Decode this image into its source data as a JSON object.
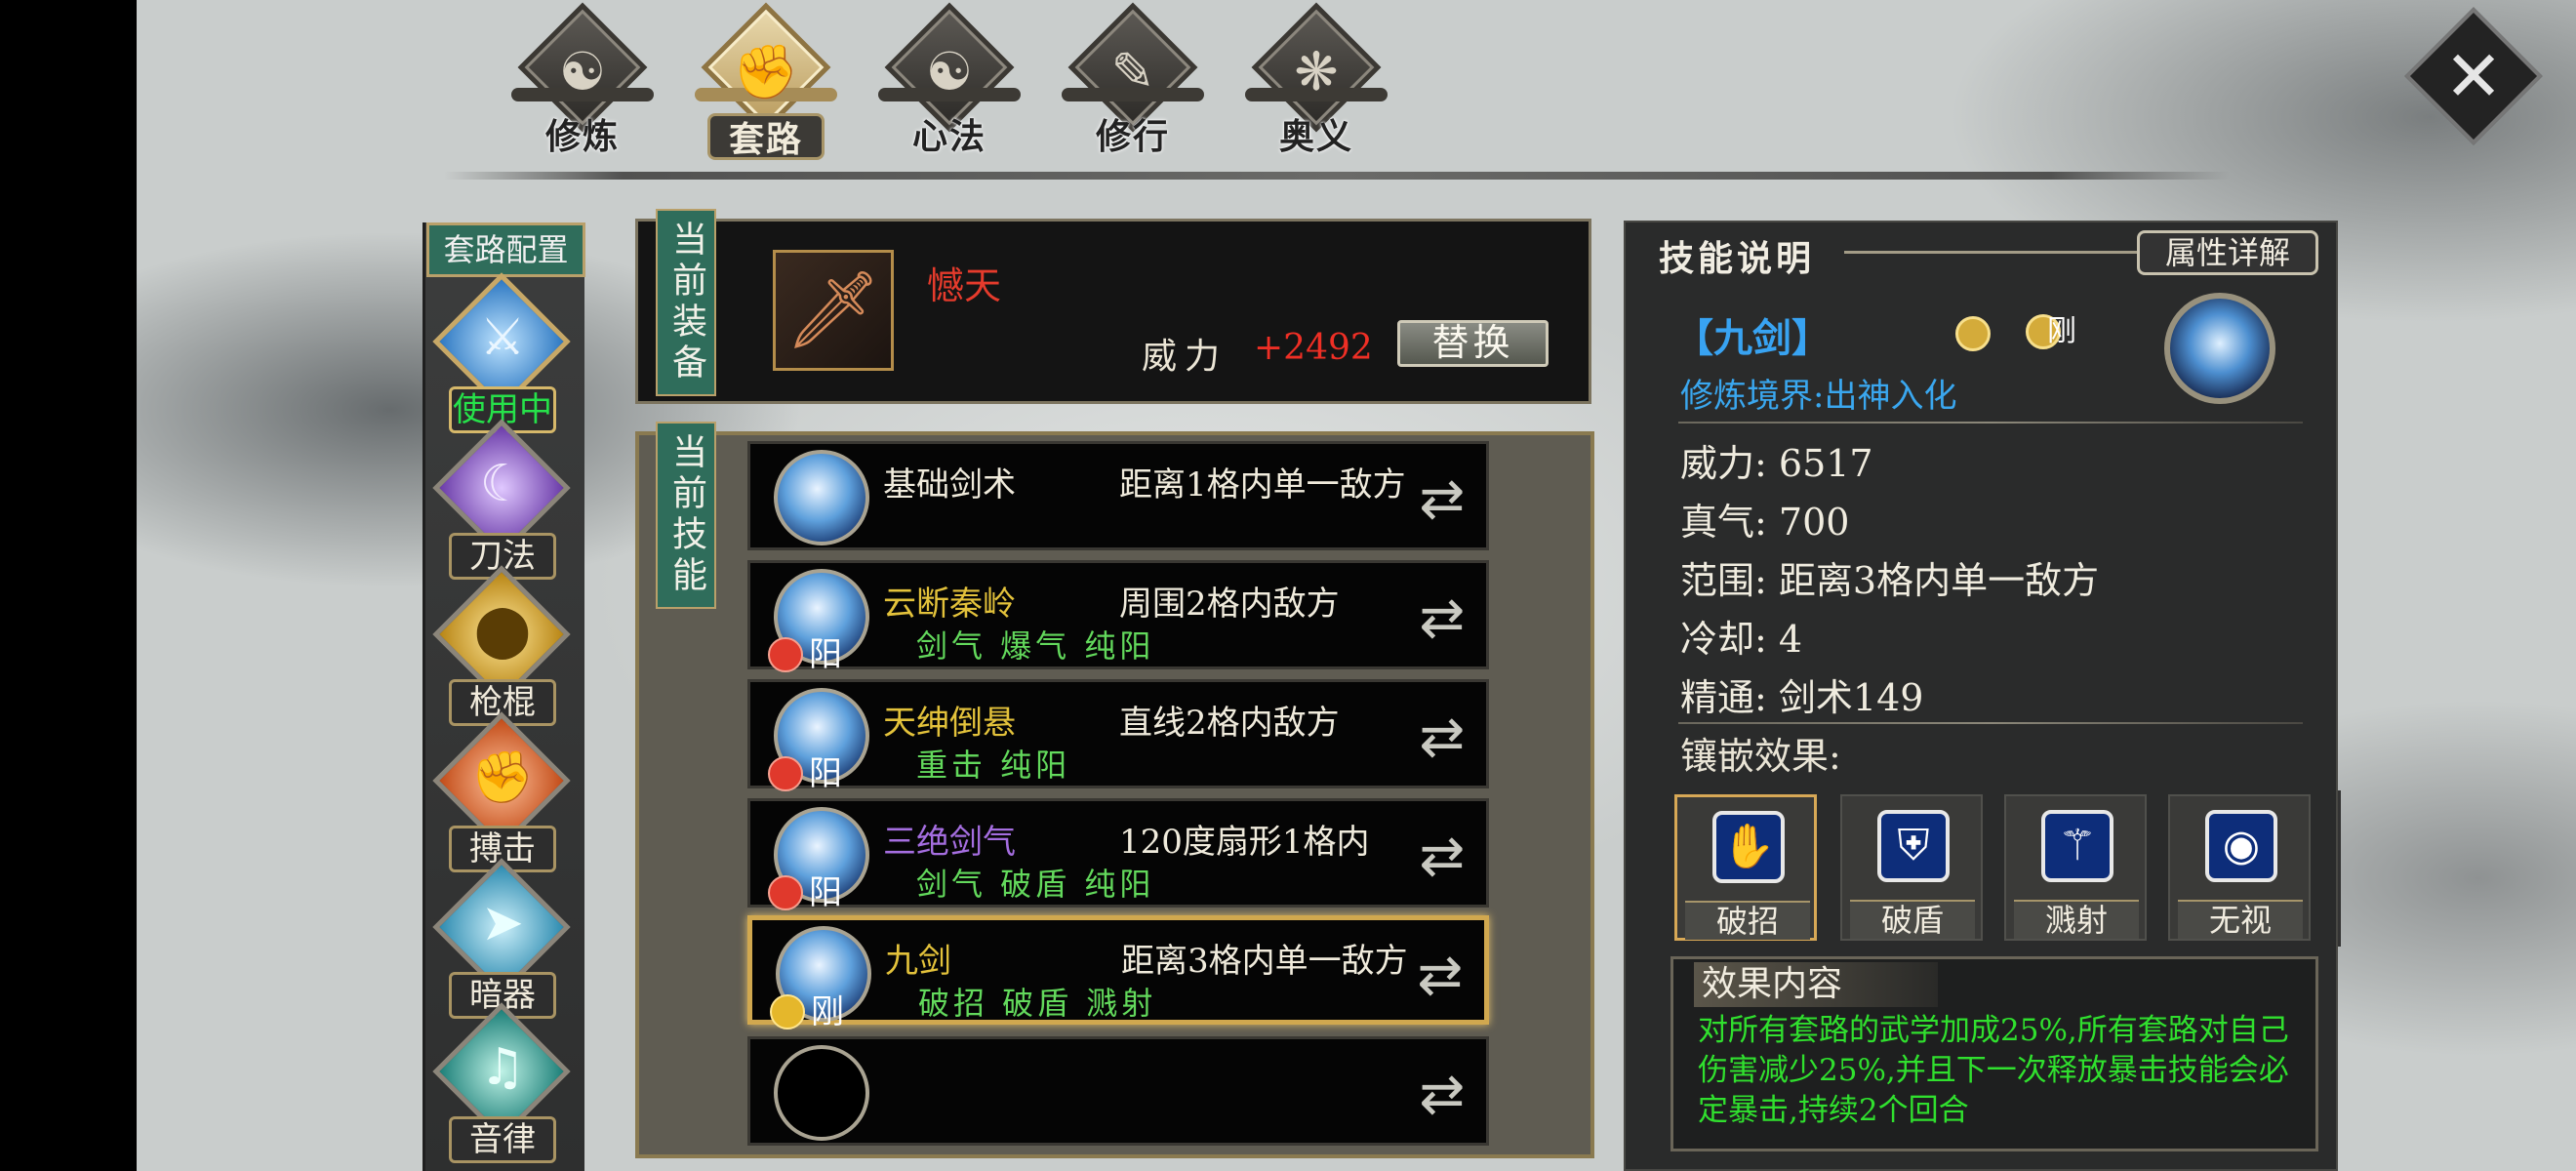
{
  "top_tabs": [
    {
      "label": "修炼",
      "icon": "swirl-icon"
    },
    {
      "label": "套路",
      "icon": "fist-icon"
    },
    {
      "label": "心法",
      "icon": "yinyang-icon"
    },
    {
      "label": "修行",
      "icon": "scroll-icon"
    },
    {
      "label": "奥义",
      "icon": "flame-icon"
    }
  ],
  "active_tab": "套路",
  "sidebar": {
    "title": "套路配置",
    "items": [
      {
        "label": "使用中",
        "icon": "sword-icon",
        "color": "#5fb4ec"
      },
      {
        "label": "刀法",
        "icon": "blade-icon",
        "color": "#9c73d6"
      },
      {
        "label": "枪棍",
        "icon": "spear-icon",
        "color": "#e3b539"
      },
      {
        "label": "搏击",
        "icon": "fist-icon",
        "color": "#e86d36"
      },
      {
        "label": "暗器",
        "icon": "dart-icon",
        "color": "#5dc0de"
      },
      {
        "label": "音律",
        "icon": "fan-icon",
        "color": "#3ea6a0"
      }
    ]
  },
  "equipment": {
    "tag": "当前装备",
    "name": "憾天",
    "power_label": "威力",
    "power_value": "+2492",
    "replace_label": "替换"
  },
  "skills": {
    "tag": "当前技能",
    "rows": [
      {
        "name": "基础剑术",
        "name_color": "#f0ebdc",
        "range": "距离1格内单一敌方",
        "tags": "",
        "badge": ""
      },
      {
        "name": "云断秦岭",
        "name_color": "#e3c23b",
        "range": "周围2格内敌方",
        "tags": "剑气 爆气 纯阳",
        "badge": "阳"
      },
      {
        "name": "天绅倒悬",
        "name_color": "#e3c23b",
        "range": "直线2格内敌方",
        "tags": "重击 纯阳",
        "badge": "阳"
      },
      {
        "name": "三绝剑气",
        "name_color": "#a56ee0",
        "range": "120度扇形1格内",
        "tags": "剑气 破盾 纯阳",
        "badge": "阳"
      },
      {
        "name": "九剑",
        "name_color": "#e3c23b",
        "range": "距离3格内单一敌方",
        "tags": "破招 破盾 溅射",
        "badge": "刚"
      },
      {
        "name": "",
        "name_color": "#f0ebdc",
        "range": "",
        "tags": "",
        "badge": ""
      }
    ]
  },
  "detail": {
    "title": "技能说明",
    "attr_button": "属性详解",
    "skill_name": "【九剑】",
    "gem_label": "刚",
    "realm": "修炼境界:出神入化",
    "stats": [
      {
        "label": "威力:",
        "value": "6517"
      },
      {
        "label": "真气:",
        "value": "700"
      },
      {
        "label": "范围:",
        "value": "距离3格内单一敌方"
      },
      {
        "label": "冷却:",
        "value": "4"
      },
      {
        "label": "精通:",
        "value": "剑术149"
      }
    ],
    "embed_title": "镶嵌效果:",
    "embeds": [
      {
        "label": "破招",
        "icon": "palm-icon"
      },
      {
        "label": "破盾",
        "icon": "shield-icon"
      },
      {
        "label": "溅射",
        "icon": "splash-icon"
      },
      {
        "label": "无视",
        "icon": "eye-icon"
      }
    ],
    "effect_title": "效果内容",
    "effect_text": "对所有套路的武学加成25%,所有套路对自己伤害减少25%,并且下一次释放暴击技能会必定暴击,持续2个回合"
  }
}
